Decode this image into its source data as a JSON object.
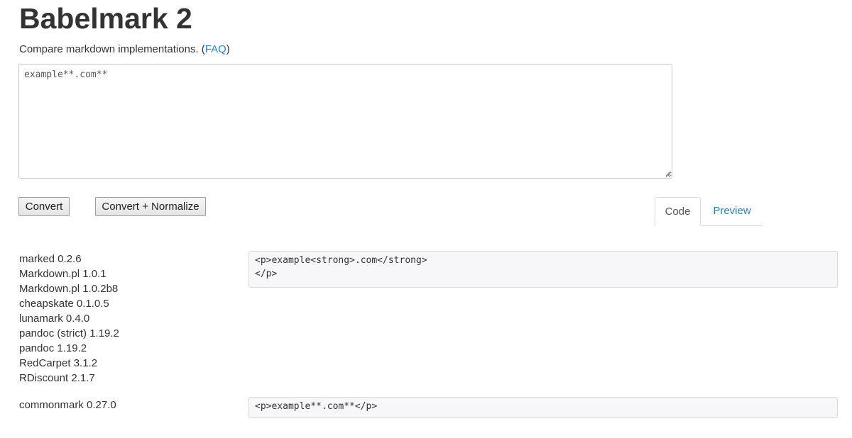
{
  "header": {
    "title": "Babelmark 2",
    "subtitle_prefix": "Compare markdown implementations. (",
    "faq_label": "FAQ",
    "subtitle_suffix": ")"
  },
  "editor": {
    "value": "example**.com**"
  },
  "toolbar": {
    "convert_label": "Convert",
    "normalize_label": "Convert + Normalize"
  },
  "tabs": {
    "code_label": "Code",
    "preview_label": "Preview",
    "active": "Code"
  },
  "results": [
    {
      "implementations": [
        "marked 0.2.6",
        "Markdown.pl 1.0.1",
        "Markdown.pl 1.0.2b8",
        "cheapskate 0.1.0.5",
        "lunamark 0.4.0",
        "pandoc (strict) 1.19.2",
        "pandoc 1.19.2",
        "RedCarpet 3.1.2",
        "RDiscount 2.1.7"
      ],
      "output": "<p>example<strong>.com</strong>\n</p>"
    },
    {
      "implementations": [
        "commonmark 0.27.0"
      ],
      "output": "<p>example**.com**</p>"
    }
  ],
  "colors": {
    "link": "#2a82c6",
    "text": "#333333",
    "code_bg": "#f7f7f9"
  }
}
